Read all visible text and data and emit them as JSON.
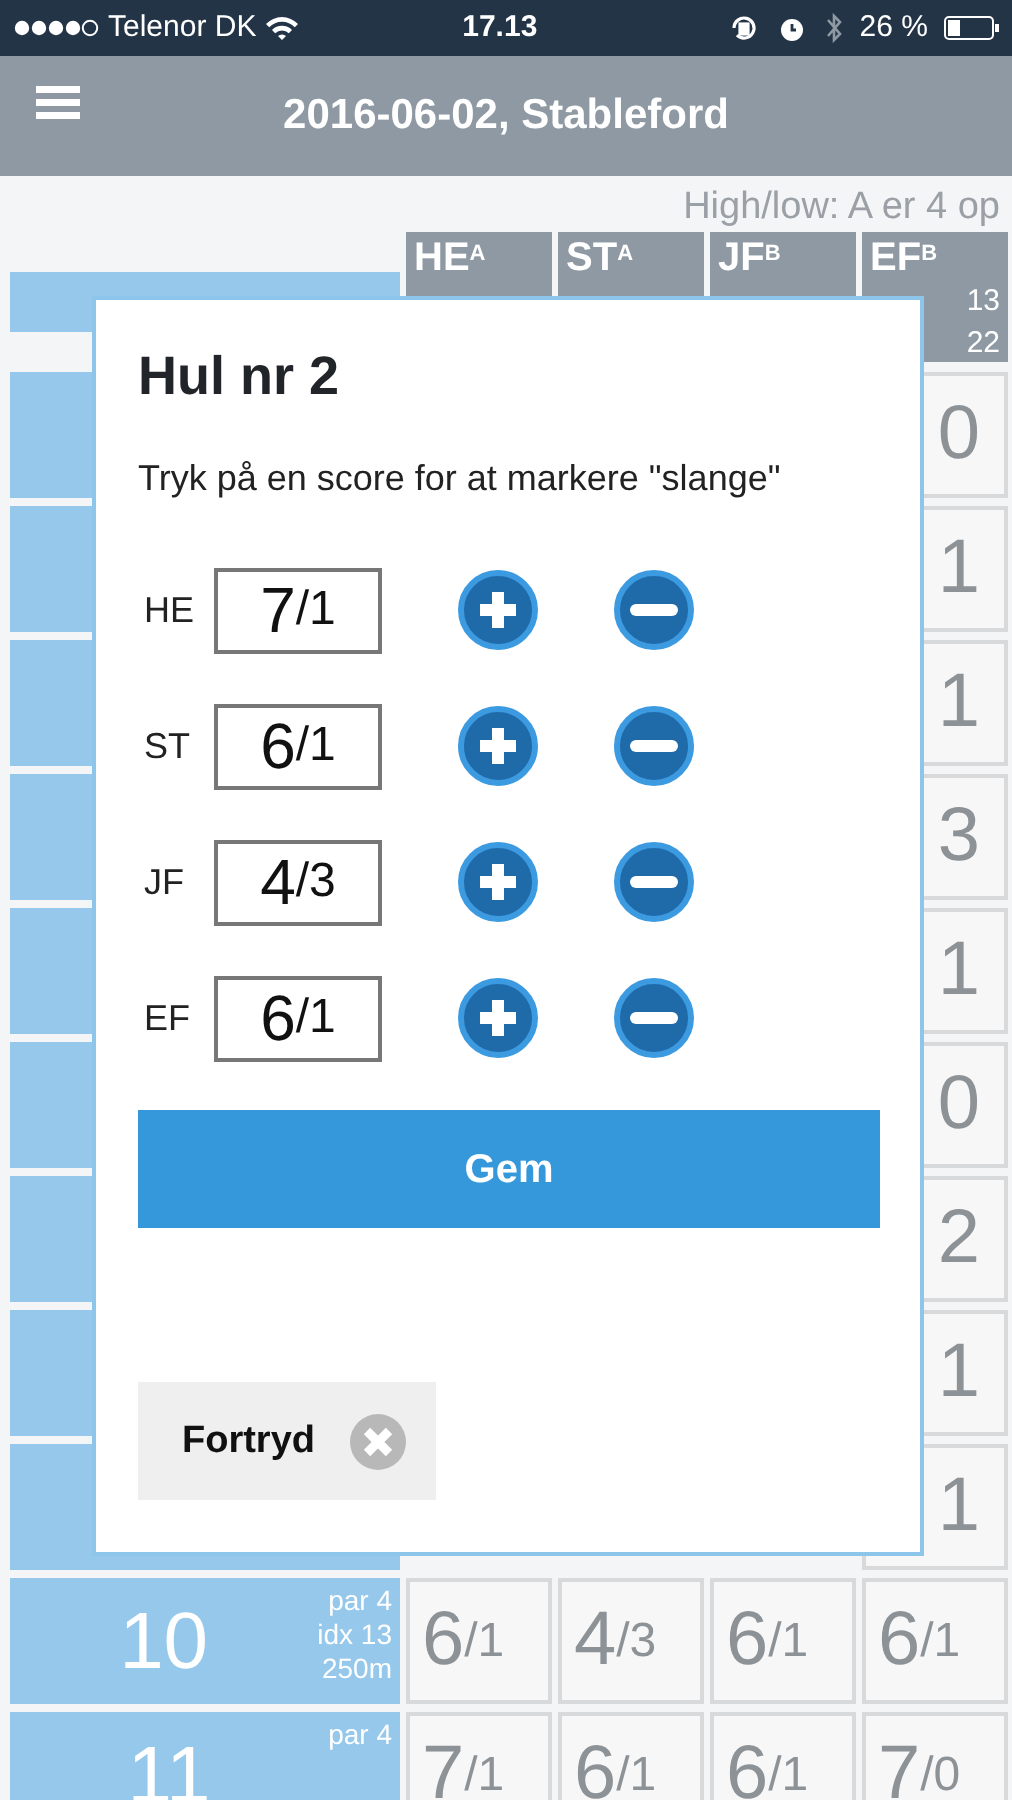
{
  "status_bar": {
    "carrier": "Telenor DK",
    "time": "17.13",
    "battery": "26 %"
  },
  "nav": {
    "title": "2016-06-02, Stableford"
  },
  "handicap_note": "High/low: A er 4 op",
  "columns": [
    {
      "initials": "HE",
      "group": "A"
    },
    {
      "initials": "ST",
      "group": "A"
    },
    {
      "initials": "JF",
      "group": "B"
    },
    {
      "initials": "EF",
      "group": "B",
      "lines": [
        "13",
        "22"
      ]
    }
  ],
  "rows": [
    {
      "kind": "covered",
      "fragment": "0"
    },
    {
      "kind": "covered",
      "fragment": "1"
    },
    {
      "kind": "covered",
      "fragment": "1"
    },
    {
      "kind": "covered",
      "fragment": "3"
    },
    {
      "kind": "covered",
      "fragment": "1"
    },
    {
      "kind": "covered",
      "fragment": "0"
    },
    {
      "kind": "covered",
      "fragment": "2"
    },
    {
      "kind": "covered",
      "fragment": "1"
    },
    {
      "kind": "covered",
      "fragment": "1"
    },
    {
      "kind": "hole",
      "hole": "10",
      "info": [
        "par 4",
        "idx 13",
        "250m"
      ],
      "scores": [
        {
          "strokes": "6",
          "points": "/1"
        },
        {
          "strokes": "4",
          "points": "/3"
        },
        {
          "strokes": "6",
          "points": "/1"
        },
        {
          "strokes": "6",
          "points": "/1"
        }
      ]
    },
    {
      "kind": "hole",
      "hole": "11",
      "info": [
        "par 4"
      ],
      "scores": [
        {
          "strokes": "7",
          "points": "/1"
        },
        {
          "strokes": "6",
          "points": "/1"
        },
        {
          "strokes": "6",
          "points": "/1"
        },
        {
          "strokes": "7",
          "points": "/0"
        }
      ]
    }
  ],
  "dialog": {
    "title": "Hul nr 2",
    "instruction": "Tryk på en score for at markere \"slange\"",
    "players": [
      {
        "initials": "HE",
        "strokes": "7",
        "points": "/1"
      },
      {
        "initials": "ST",
        "strokes": "6",
        "points": "/1"
      },
      {
        "initials": "JF",
        "strokes": "4",
        "points": "/3"
      },
      {
        "initials": "EF",
        "strokes": "6",
        "points": "/1"
      }
    ],
    "save": "Gem",
    "cancel": "Fortryd"
  }
}
